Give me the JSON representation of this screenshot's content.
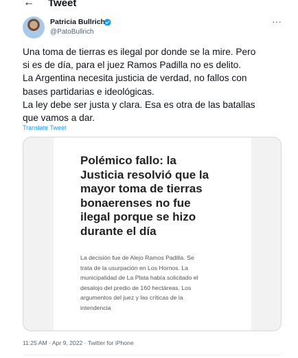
{
  "header": {
    "back_icon": "arrow-left-icon",
    "back_glyph": "←",
    "title": "Tweet"
  },
  "author": {
    "name": "Patricia Bullrich",
    "handle": "@PatoBullrich",
    "verified": true,
    "verified_color": "#1d9bf0"
  },
  "more_glyph": "···",
  "tweet": {
    "lines": [
      "Una toma de tierras es ilegal por donde se la mire. Pero",
      "si es de día, para el juez Ramos Padilla no es delito.",
      "La Argentina necesita justicia de verdad, no fallos con",
      "bases partidarias e ideológicas.",
      "La ley debe ser justa y clara. Esa es otra de las batallas",
      "que vamos a dar."
    ],
    "translate_label": "Translate Tweet"
  },
  "card": {
    "headline_lines": [
      "Polémico fallo: la",
      "Justicia resolvió que la",
      "mayor toma de tierras",
      "bonaerenses no fue",
      "ilegal porque se hizo",
      "durante el día"
    ],
    "body_lines": [
      "La decisión fue de Alejo Ramos Padilla. Se",
      "trata de la usurpación en Los Hornos. La",
      "municipalidad de La Plata había solicitado el",
      "desalojo del predio de 160 hectáreas. Los",
      "argumentos del juez y las críticas de la",
      "intendencia"
    ]
  },
  "meta": {
    "text": "11:25 AM · Apr 9, 2022 · Twitter for iPhone"
  }
}
